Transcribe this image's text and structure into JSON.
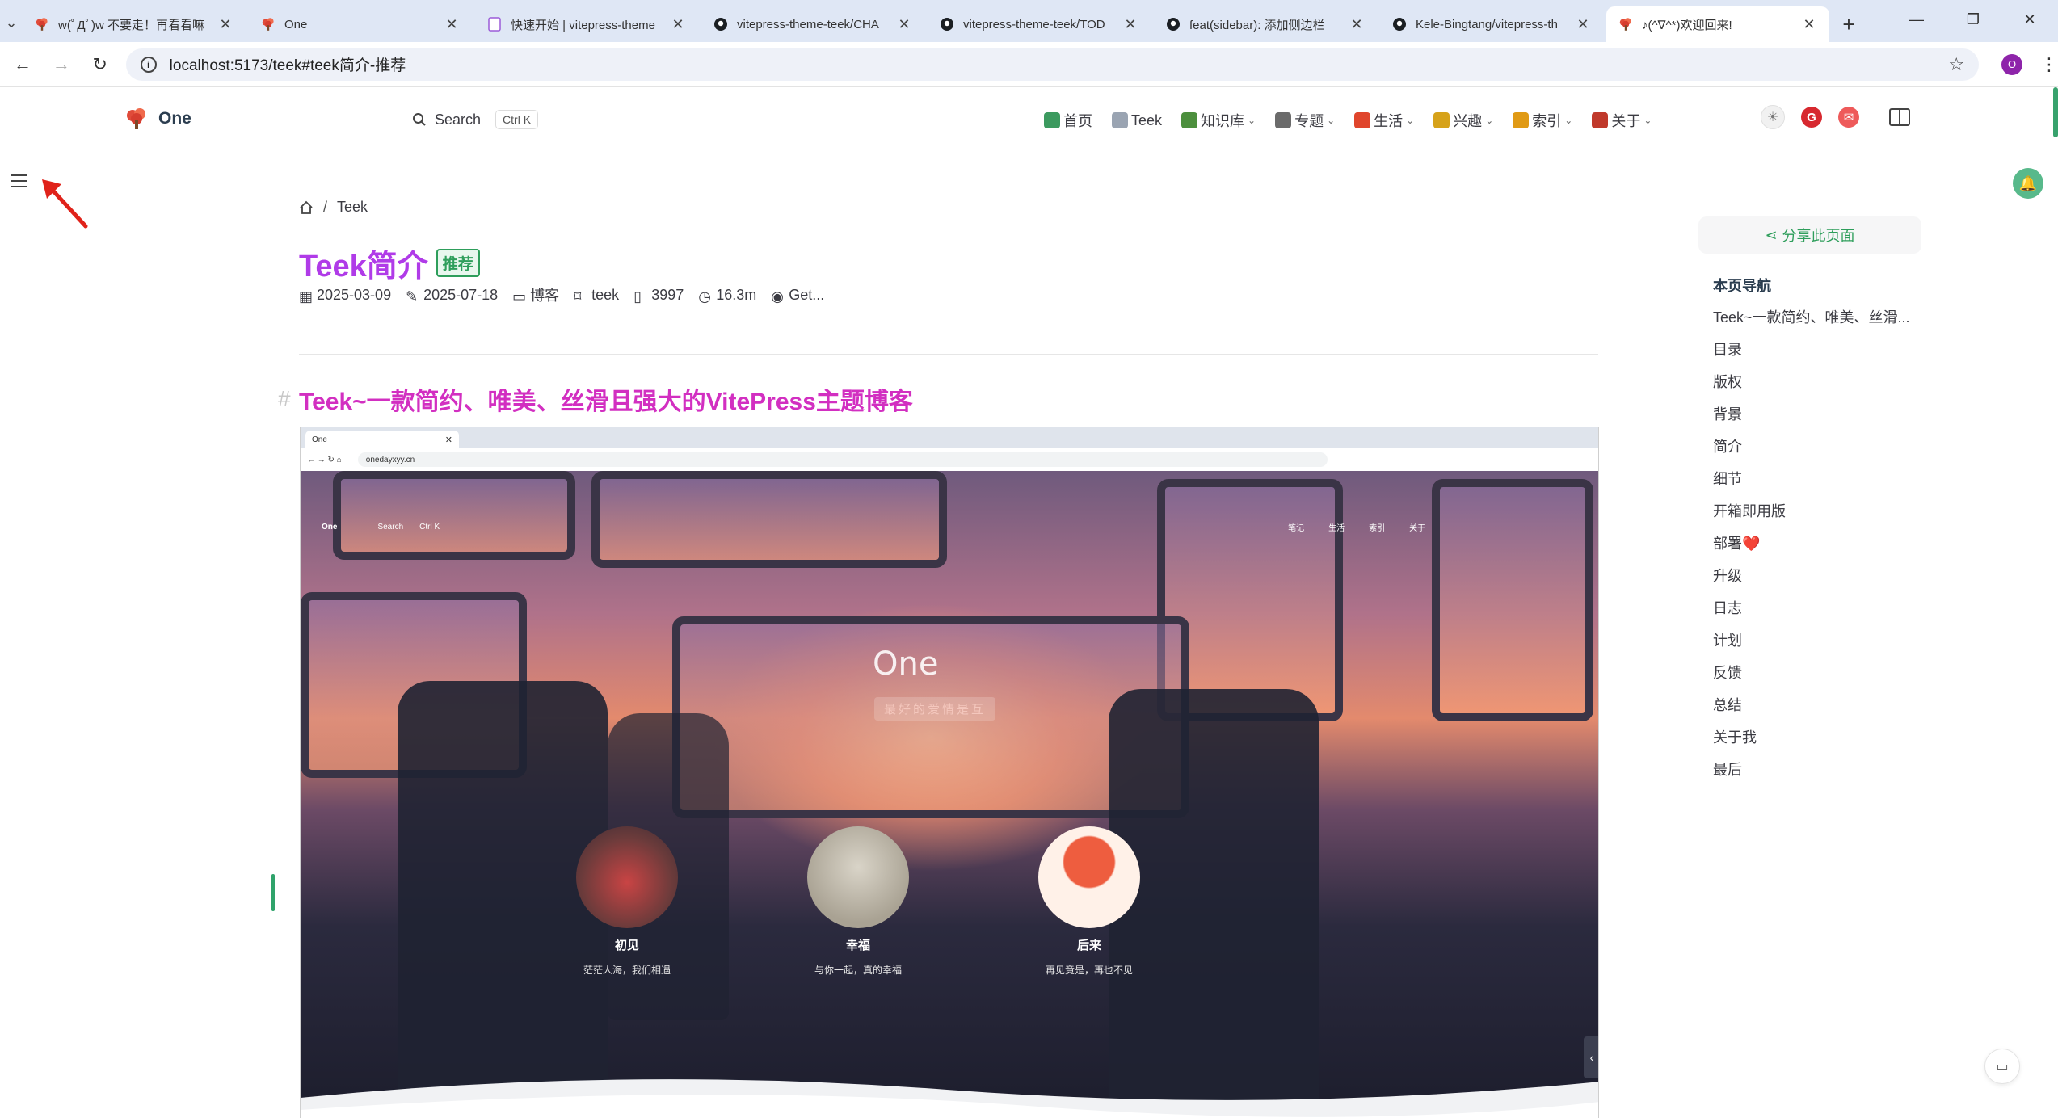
{
  "browser": {
    "tabs": [
      {
        "title": "w(ﾟДﾟ)w 不要走！再看看嘛",
        "favicon": "tree-icon",
        "active": false
      },
      {
        "title": "One",
        "favicon": "tree-icon",
        "active": false
      },
      {
        "title": "快速开始 | vitepress-theme",
        "favicon": "doc-icon",
        "active": false
      },
      {
        "title": "vitepress-theme-teek/CHA",
        "favicon": "github-icon",
        "active": false
      },
      {
        "title": "vitepress-theme-teek/TOD",
        "favicon": "github-icon",
        "active": false
      },
      {
        "title": "feat(sidebar): 添加侧边栏",
        "favicon": "github-icon",
        "active": false
      },
      {
        "title": "Kele-Bingtang/vitepress-th",
        "favicon": "github-icon",
        "active": false
      },
      {
        "title": "♪(^∇^*)欢迎回来!",
        "favicon": "tree-icon",
        "active": true
      }
    ],
    "url": "localhost:5173/teek#teek简介-推荐",
    "profile_initial": "O"
  },
  "site": {
    "brand": "One",
    "search_label": "Search",
    "search_kbd": "Ctrl K",
    "nav": [
      {
        "label": "首页",
        "icon": "house-icon",
        "color": "#3c9a5f",
        "dropdown": false
      },
      {
        "label": "Teek",
        "icon": "doc-icon",
        "color": "#9aa4b2",
        "dropdown": false
      },
      {
        "label": "知识库",
        "icon": "book-icon",
        "color": "#4c8f3d",
        "dropdown": true
      },
      {
        "label": "专题",
        "icon": "tools-icon",
        "color": "#6b6b6b",
        "dropdown": true
      },
      {
        "label": "生活",
        "icon": "chat-icon",
        "color": "#e0452c",
        "dropdown": true
      },
      {
        "label": "兴趣",
        "icon": "ball-icon",
        "color": "#d6a21a",
        "dropdown": true
      },
      {
        "label": "索引",
        "icon": "tag-icon",
        "color": "#e09a15",
        "dropdown": true
      },
      {
        "label": "关于",
        "icon": "pin-icon",
        "color": "#c0392b",
        "dropdown": true
      }
    ],
    "social": [
      {
        "icon": "gitee-icon",
        "color": "#d7282f",
        "glyph": "G"
      },
      {
        "icon": "mail-icon",
        "color": "#ee5a5a",
        "glyph": "✉"
      }
    ]
  },
  "article": {
    "breadcrumb": [
      "Teek"
    ],
    "title": "Teek简介",
    "badge": "推荐",
    "meta": {
      "created": "2025-03-09",
      "updated": "2025-07-18",
      "category": "博客",
      "tag": "teek",
      "words": "3997",
      "reading_time": "16.3m",
      "views": "Get..."
    },
    "heading": "Teek~一款简约、唯美、丝滑且强大的VitePress主题博客"
  },
  "embedded": {
    "tab_title": "One",
    "url": "onedayxyy.cn",
    "brand": "One",
    "search": "Search",
    "kbd": "Ctrl K",
    "nav_items": [
      "笔记",
      "生活",
      "索引",
      "关于"
    ],
    "hero_title": "One",
    "hero_sub": "最好的爱情是互",
    "cards": [
      {
        "name": "初见",
        "desc": "茫茫人海，我们相遇",
        "color": "#b03b3b"
      },
      {
        "name": "幸福",
        "desc": "与你一起，真的幸福",
        "color": "#b7b2a6"
      },
      {
        "name": "后来",
        "desc": "再见竟是，再也不见",
        "color": "#e35b3e"
      }
    ]
  },
  "aside": {
    "share": "分享此页面",
    "outline_title": "本页导航",
    "outline": [
      "Teek~一款简约、唯美、丝滑...",
      "目录",
      "版权",
      "背景",
      "简介",
      "细节",
      "开箱即用版",
      "部署❤️",
      "升级",
      "日志",
      "计划",
      "反馈",
      "总结",
      "关于我",
      "最后"
    ]
  },
  "colors": {
    "title": "#b03be8",
    "heading": "#d22fc1",
    "accent_green": "#2e9e5b"
  }
}
